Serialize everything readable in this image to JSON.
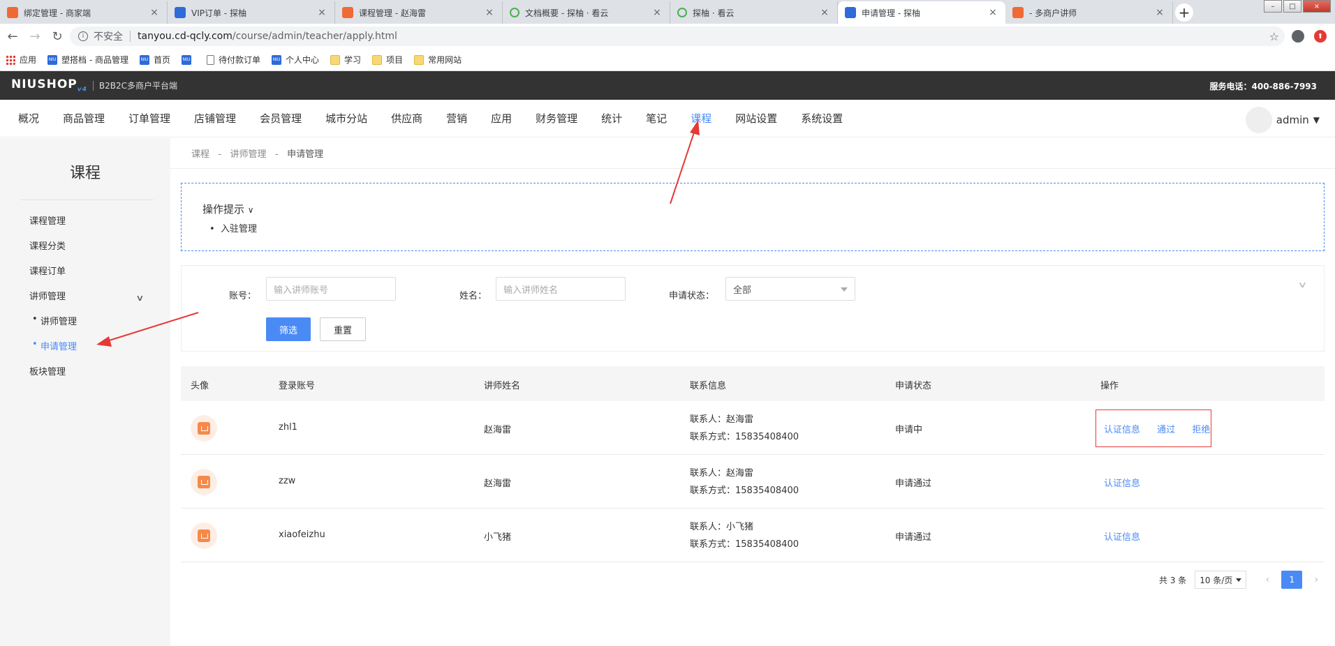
{
  "browser": {
    "tabs": [
      {
        "title": "绑定管理 - 商家端",
        "icon": "orange"
      },
      {
        "title": "VIP订单 - 探柚",
        "icon": "blue"
      },
      {
        "title": "课程管理 - 赵海雷",
        "icon": "orange"
      },
      {
        "title": "文档概要 - 探柚 · 看云",
        "icon": "green"
      },
      {
        "title": "探柚 · 看云",
        "icon": "green"
      },
      {
        "title": "申请管理 - 探柚",
        "icon": "blue",
        "active": true
      },
      {
        "title": "- 多商户讲师",
        "icon": "orange"
      }
    ],
    "address": {
      "security": "不安全",
      "host": "tanyou.cd-qcly.com",
      "path": "/course/admin/teacher/apply.html"
    },
    "bookmarks": [
      "应用",
      "塑搭档 - 商品管理",
      "首页",
      "",
      "待付款订单",
      "个人中心",
      "学习",
      "项目",
      "常用网站"
    ]
  },
  "header": {
    "logo": "NIUSHOP",
    "logo_version": "v4",
    "subtitle": "B2B2C多商户平台端",
    "hotline": "服务电话：400-886-7993"
  },
  "nav": {
    "items": [
      "概况",
      "商品管理",
      "订单管理",
      "店铺管理",
      "会员管理",
      "城市分站",
      "供应商",
      "营销",
      "应用",
      "财务管理",
      "统计",
      "笔记",
      "课程",
      "网站设置",
      "系统设置"
    ],
    "active": "课程",
    "user": "admin"
  },
  "sidebar": {
    "title": "课程",
    "items": [
      "课程管理",
      "课程分类",
      "课程订单",
      "讲师管理"
    ],
    "subitems": [
      "讲师管理",
      "申请管理"
    ],
    "last": "板块管理"
  },
  "breadcrumb": [
    "课程",
    "讲师管理",
    "申请管理"
  ],
  "tips": {
    "title": "操作提示",
    "items": [
      "入驻管理"
    ]
  },
  "filter": {
    "account_label": "账号：",
    "account_placeholder": "输入讲师账号",
    "name_label": "姓名：",
    "name_placeholder": "输入讲师姓名",
    "status_label": "申请状态：",
    "status_value": "全部",
    "search_btn": "筛选",
    "reset_btn": "重置"
  },
  "table": {
    "headers": [
      "头像",
      "登录账号",
      "讲师姓名",
      "联系信息",
      "申请状态",
      "操作"
    ],
    "rows": [
      {
        "account": "zhl1",
        "name": "赵海雷",
        "contact_person": "联系人：赵海雷",
        "contact_phone": "联系方式：15835408400",
        "status": "申请中",
        "actions": [
          "认证信息",
          "通过",
          "拒绝"
        ]
      },
      {
        "account": "zzw",
        "name": "赵海雷",
        "contact_person": "联系人：赵海雷",
        "contact_phone": "联系方式：15835408400",
        "status": "申请通过",
        "actions": [
          "认证信息"
        ]
      },
      {
        "account": "xiaofeizhu",
        "name": "小飞猪",
        "contact_person": "联系人：小飞猪",
        "contact_phone": "联系方式：15835408400",
        "status": "申请通过",
        "actions": [
          "认证信息"
        ]
      }
    ]
  },
  "pager": {
    "total": "共 3 条",
    "size": "10 条/页",
    "current": "1"
  },
  "colors": {
    "primary": "#4a8af4",
    "header_bg": "#333333",
    "annotation": "#e53935"
  }
}
